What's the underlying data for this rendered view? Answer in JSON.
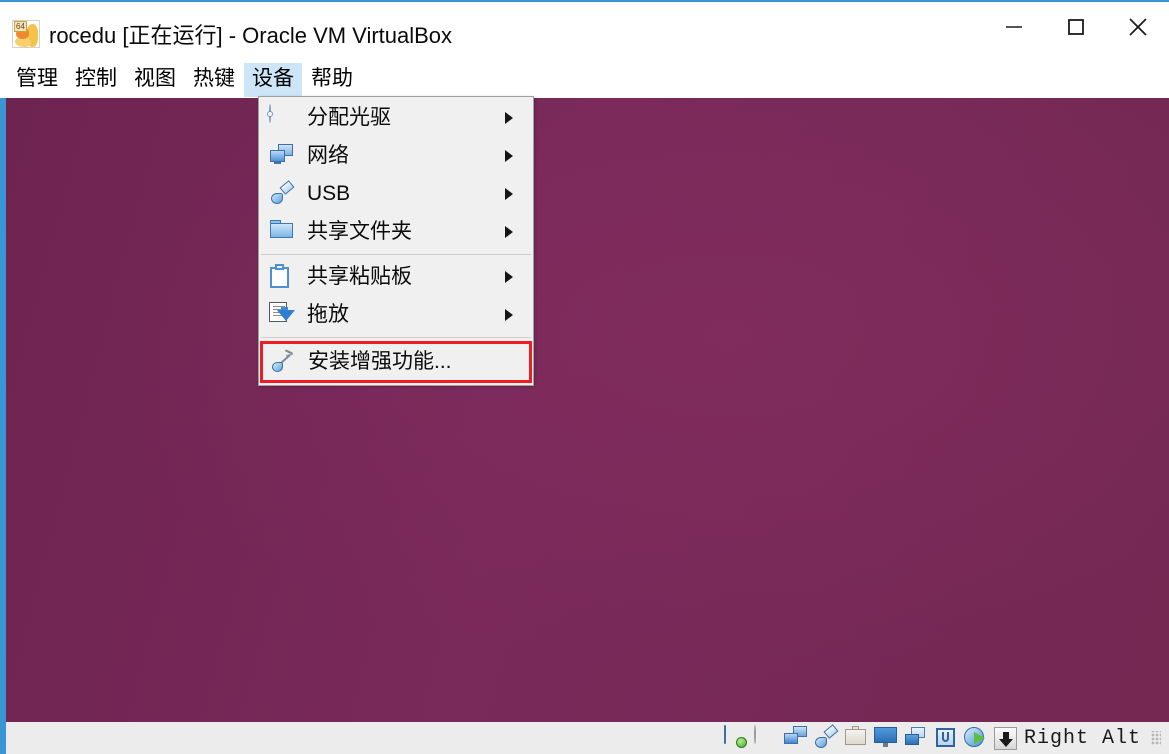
{
  "window": {
    "title": "rocedu [正在运行] - Oracle VM VirtualBox",
    "icon": "virtualbox-vm-icon",
    "icon_badge": "64",
    "controls": {
      "minimize": "minimize-icon",
      "maximize": "maximize-icon",
      "close": "close-icon"
    }
  },
  "menubar": {
    "items": [
      {
        "label": "管理",
        "active": false
      },
      {
        "label": "控制",
        "active": false
      },
      {
        "label": "视图",
        "active": false
      },
      {
        "label": "热键",
        "active": false
      },
      {
        "label": "设备",
        "active": true
      },
      {
        "label": "帮助",
        "active": false
      }
    ]
  },
  "devices_menu": {
    "open": true,
    "items": [
      {
        "label": "分配光驱",
        "icon": "optical-disc-icon",
        "submenu": true,
        "separator_after": false,
        "highlighted": false
      },
      {
        "label": "网络",
        "icon": "network-icon",
        "submenu": true,
        "separator_after": false,
        "highlighted": false
      },
      {
        "label": "USB",
        "icon": "usb-icon",
        "submenu": true,
        "separator_after": false,
        "highlighted": false
      },
      {
        "label": "共享文件夹",
        "icon": "shared-folder-icon",
        "submenu": true,
        "separator_after": true,
        "highlighted": false
      },
      {
        "label": "共享粘贴板",
        "icon": "clipboard-icon",
        "submenu": true,
        "separator_after": false,
        "highlighted": false
      },
      {
        "label": "拖放",
        "icon": "drag-drop-icon",
        "submenu": true,
        "separator_after": true,
        "highlighted": false
      },
      {
        "label": "安装增强功能...",
        "icon": "guest-additions-icon",
        "submenu": false,
        "separator_after": false,
        "highlighted": true
      }
    ],
    "highlight_color": "#ee1c24"
  },
  "vm_screen": {
    "background_color": "#772953",
    "content": ""
  },
  "statusbar": {
    "icons": [
      "hard-disk-icon",
      "optical-disc-icon",
      "network-icon",
      "usb-icon",
      "shared-folder-icon",
      "display-icon",
      "recording-icon",
      "cpu-icon",
      "mouse-integration-icon"
    ],
    "host_key_icon": "host-key-icon",
    "host_key_label": "Right Alt",
    "resize_grip": "resize-grip-icon"
  },
  "colors": {
    "accent_border": "#3a95d4",
    "menu_active": "#cde6f7",
    "desktop_purple": "#772953",
    "menu_background": "#f0f0f0",
    "statusbar_background": "#ececed"
  }
}
